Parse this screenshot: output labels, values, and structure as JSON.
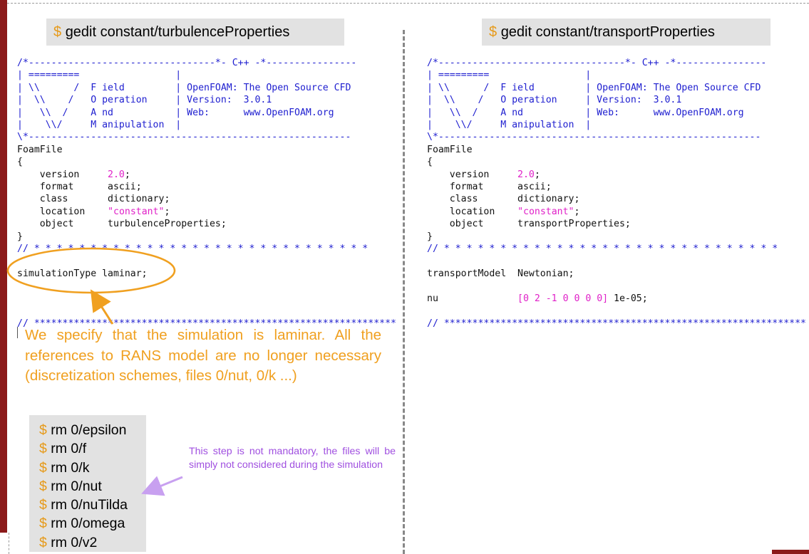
{
  "left": {
    "command": "gedit constant/turbulenceProperties",
    "header": {
      "line1": "/*---------------------------------*- C++ -*----------------",
      "line2": "| =========                 |",
      "line3": "| \\\\      /  F ield         | OpenFOAM: The Open Source CFD",
      "line4": "|  \\\\    /   O peration     | Version:  3.0.1",
      "line5": "|   \\\\  /    A nd           | Web:      www.OpenFOAM.org",
      "line6": "|    \\\\/     M anipulation  |",
      "line7": "\\*---------------------------------------------------------"
    },
    "foamfile": "FoamFile",
    "open_brace": "{",
    "close_brace": "}",
    "entries": [
      {
        "key": "version",
        "value": "2.0",
        "suffix": ";"
      },
      {
        "key": "format",
        "value": "ascii;",
        "suffix": ""
      },
      {
        "key": "class",
        "value": "dictionary;",
        "suffix": ""
      },
      {
        "key": "location",
        "value": "\"constant\"",
        "suffix": ";"
      },
      {
        "key": "object",
        "value": "turbulenceProperties;",
        "suffix": ""
      }
    ],
    "star_line": "// * * * * * * * * * * * * * * * * * * * * * * * * * * * * * *",
    "body_line": "simulationType laminar;",
    "end_line": "// ****************************************************************",
    "note": "We specify that the simulation is laminar. All the references to  RANS model are no longer necessary (discretization schemes, files 0/nut, 0/k ...)",
    "rm_commands": [
      "rm 0/epsilon",
      "rm 0/f",
      "rm 0/k",
      "rm 0/nut",
      "rm 0/nuTilda",
      "rm 0/omega",
      "rm 0/v2"
    ],
    "tip": "This step is not mandatory, the files will be simply not considered during the simulation"
  },
  "right": {
    "command": "gedit constant/transportProperties",
    "header": {
      "line1": "/*---------------------------------*- C++ -*----------------",
      "line2": "| =========                 |",
      "line3": "| \\\\      /  F ield         | OpenFOAM: The Open Source CFD",
      "line4": "|  \\\\    /   O peration     | Version:  3.0.1",
      "line5": "|   \\\\  /    A nd           | Web:      www.OpenFOAM.org",
      "line6": "|    \\\\/     M anipulation  |",
      "line7": "\\*---------------------------------------------------------"
    },
    "foamfile": "FoamFile",
    "open_brace": "{",
    "close_brace": "}",
    "entries": [
      {
        "key": "version",
        "value": "2.0",
        "suffix": ";"
      },
      {
        "key": "format",
        "value": "ascii;",
        "suffix": ""
      },
      {
        "key": "class",
        "value": "dictionary;",
        "suffix": ""
      },
      {
        "key": "location",
        "value": "\"constant\"",
        "suffix": ";"
      },
      {
        "key": "object",
        "value": "transportProperties;",
        "suffix": ""
      }
    ],
    "star_line": "// * * * * * * * * * * * * * * * * * * * * * * * * * * * * * *",
    "transport_key": "transportModel",
    "transport_value": "Newtonian;",
    "nu_key": "nu",
    "nu_dims": "[0 2 -1 0 0 0 0]",
    "nu_value": "1e-05;",
    "end_line": "// ****************************************************************"
  },
  "prompt_symbol": "$",
  "colors": {
    "accent": "#f0a020",
    "tip": "#a050e0",
    "keyword": "#2020d0",
    "value": "#e020c8",
    "brand": "#8b1a1a"
  }
}
